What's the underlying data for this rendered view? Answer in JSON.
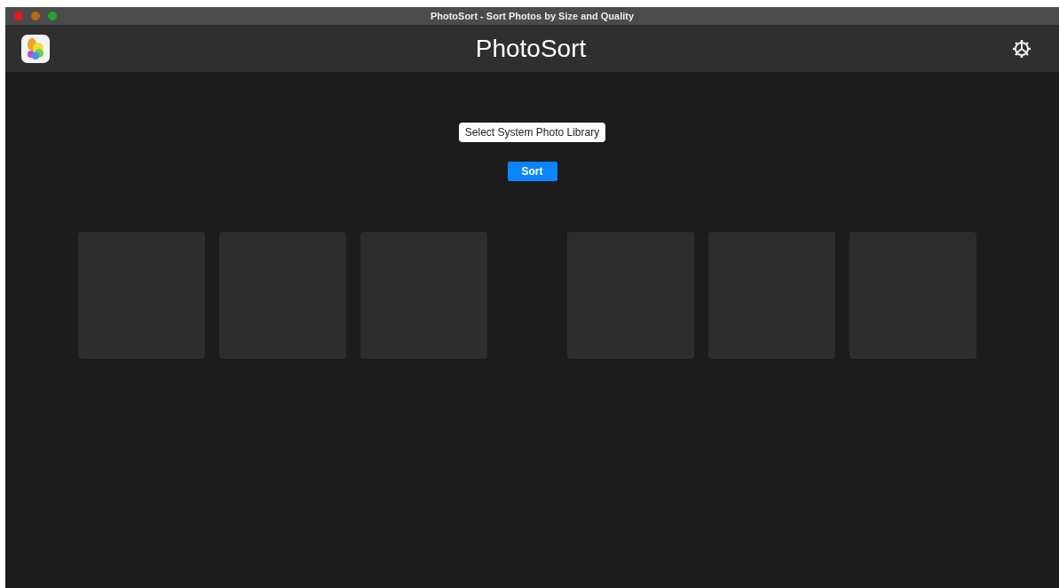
{
  "window": {
    "title": "PhotoSort - Sort Photos by Size and Quality"
  },
  "header": {
    "title": "PhotoSort"
  },
  "buttons": [
    {
      "kind": "secondary",
      "label": "Select System Photo Library"
    },
    {
      "kind": "primary",
      "label": "Sort"
    }
  ],
  "tile_groups": [
    {
      "tiles": [
        {
          "kind": "empty"
        },
        {
          "kind": "empty"
        },
        {
          "kind": "empty"
        }
      ]
    },
    {
      "tiles": [
        {
          "kind": "empty"
        },
        {
          "kind": "empty"
        },
        {
          "kind": "empty"
        }
      ]
    }
  ]
}
